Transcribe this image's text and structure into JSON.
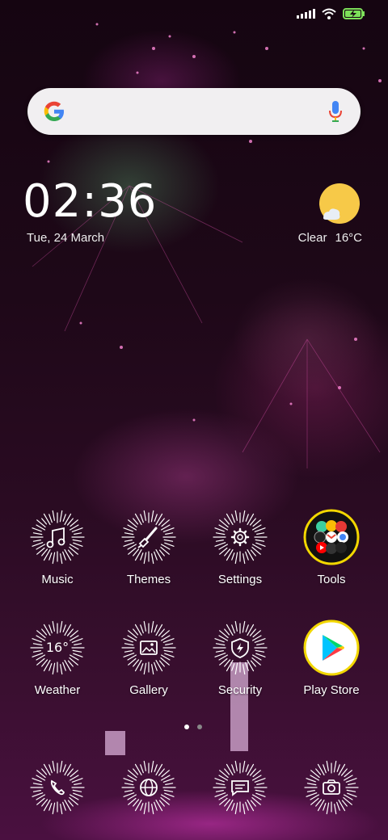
{
  "status_bar": {
    "icons": [
      "signal-icon",
      "wifi-icon",
      "battery-charging-icon"
    ]
  },
  "search": {
    "icons": [
      "google-g-icon",
      "microphone-icon"
    ]
  },
  "clock": {
    "time": "02:36",
    "date": "Tue, 24 March"
  },
  "weather": {
    "condition": "Clear",
    "temperature": "16°C",
    "icon": "sun-cloud-icon"
  },
  "apps_row1": [
    {
      "label": "Music",
      "icon": "music-note-icon"
    },
    {
      "label": "Themes",
      "icon": "paintbrush-icon"
    },
    {
      "label": "Settings",
      "icon": "gear-icon"
    },
    {
      "label": "Tools",
      "icon": "folder-icon"
    }
  ],
  "apps_row2": [
    {
      "label": "Weather",
      "icon_text": "16°"
    },
    {
      "label": "Gallery",
      "icon": "image-icon"
    },
    {
      "label": "Security",
      "icon": "shield-icon"
    },
    {
      "label": "Play Store",
      "icon": "play-store-icon"
    }
  ],
  "dock": [
    {
      "icon": "phone-icon"
    },
    {
      "icon": "browser-globe-icon"
    },
    {
      "icon": "messages-icon"
    },
    {
      "icon": "camera-icon"
    }
  ],
  "pager": {
    "pages": 2,
    "current": 1
  },
  "colors": {
    "firework_stroke": "#ffffff",
    "sun": "#f7c948",
    "play_ring": "#f2d700",
    "search_bg": "#f1eff1"
  }
}
